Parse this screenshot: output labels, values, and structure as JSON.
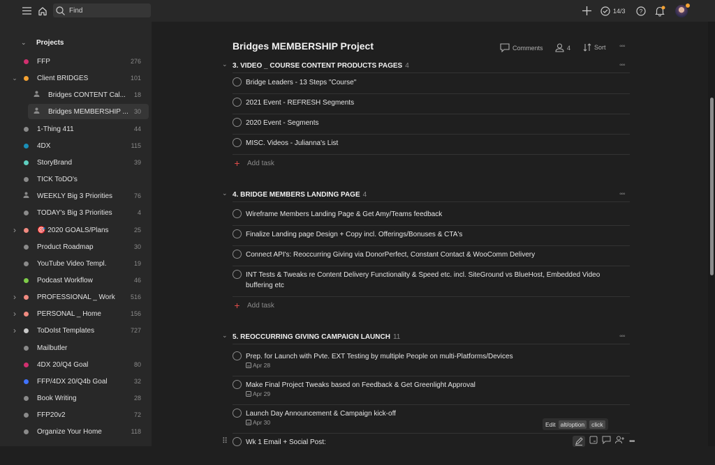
{
  "topbar": {
    "search_placeholder": "Find",
    "karma": "14/3"
  },
  "sidebar": {
    "projects_label": "Projects",
    "items": [
      {
        "label": "FFP",
        "count": "276",
        "color": "#d1306f",
        "type": "dot",
        "expand": "",
        "indent": 0
      },
      {
        "label": "Client BRIDGES",
        "count": "101",
        "color": "#f4a233",
        "type": "dot",
        "expand": "open",
        "indent": 0
      },
      {
        "label": "Bridges CONTENT Cal...",
        "count": "18",
        "color": "",
        "type": "person",
        "expand": "",
        "indent": 1
      },
      {
        "label": "Bridges MEMBERSHIP ...",
        "count": "30",
        "color": "",
        "type": "person",
        "expand": "",
        "indent": 1,
        "active": true
      },
      {
        "label": "1-Thing 411",
        "count": "44",
        "color": "#8a8a8a",
        "type": "dot",
        "expand": "",
        "indent": 0
      },
      {
        "label": "4DX",
        "count": "115",
        "color": "#1a8fb8",
        "type": "dot",
        "expand": "",
        "indent": 0
      },
      {
        "label": "StoryBrand",
        "count": "39",
        "color": "#5ecfc0",
        "type": "dot",
        "expand": "",
        "indent": 0
      },
      {
        "label": "TICK ToDO's",
        "count": "",
        "color": "#8a8a8a",
        "type": "dot",
        "expand": "",
        "indent": 0
      },
      {
        "label": "WEEKLY Big 3 Priorities",
        "count": "76",
        "color": "",
        "type": "person",
        "expand": "",
        "indent": 0
      },
      {
        "label": "TODAY's Big 3 Priorities",
        "count": "4",
        "color": "#8a8a8a",
        "type": "dot",
        "expand": "",
        "indent": 0
      },
      {
        "label": "🎯 2020 GOALS/Plans",
        "count": "25",
        "color": "#f08a80",
        "type": "dot",
        "expand": "closed",
        "indent": 0
      },
      {
        "label": "Product Roadmap",
        "count": "30",
        "color": "#8a8a8a",
        "type": "dot",
        "expand": "",
        "indent": 0
      },
      {
        "label": "YouTube Video Templ.",
        "count": "19",
        "color": "#8a8a8a",
        "type": "dot",
        "expand": "",
        "indent": 0
      },
      {
        "label": "Podcast Workflow",
        "count": "46",
        "color": "#7ecc49",
        "type": "dot",
        "expand": "",
        "indent": 0
      },
      {
        "label": "PROFESSIONAL _ Work",
        "count": "516",
        "color": "#f08a80",
        "type": "dot",
        "expand": "closed",
        "indent": 0
      },
      {
        "label": "PERSONAL _ Home",
        "count": "156",
        "color": "#f08a80",
        "type": "dot",
        "expand": "closed",
        "indent": 0
      },
      {
        "label": "ToDoIst Templates",
        "count": "727",
        "color": "#c8c8c8",
        "type": "dot",
        "expand": "closed",
        "indent": 0
      },
      {
        "label": "Mailbutler",
        "count": "",
        "color": "#8a8a8a",
        "type": "dot",
        "expand": "",
        "indent": 0
      },
      {
        "label": "4DX 20/Q4 Goal",
        "count": "80",
        "color": "#d1306f",
        "type": "dot",
        "expand": "",
        "indent": 0
      },
      {
        "label": "FFP/4DX 20/Q4b Goal",
        "count": "32",
        "color": "#4073ff",
        "type": "dot",
        "expand": "",
        "indent": 0
      },
      {
        "label": "Book Writing",
        "count": "28",
        "color": "#8a8a8a",
        "type": "dot",
        "expand": "",
        "indent": 0
      },
      {
        "label": "FFP20v2",
        "count": "72",
        "color": "#8a8a8a",
        "type": "dot",
        "expand": "",
        "indent": 0
      },
      {
        "label": "Organize Your Home",
        "count": "118",
        "color": "#8a8a8a",
        "type": "dot",
        "expand": "",
        "indent": 0
      }
    ]
  },
  "main": {
    "title": "Bridges MEMBERSHIP Project",
    "actions": {
      "comments": "Comments",
      "people_count": "4",
      "sort": "Sort"
    },
    "sections": [
      {
        "title": "3. VIDEO _ COURSE CONTENT PRODUCTS PAGES",
        "count": "4",
        "tasks": [
          {
            "text": "Bridge Leaders - 13 Steps \"Course\"",
            "date": ""
          },
          {
            "text": "2021 Event - REFRESH Segments",
            "date": ""
          },
          {
            "text": "2020 Event - Segments",
            "date": ""
          },
          {
            "text": "MISC. Videos - Julianna's List",
            "date": ""
          }
        ],
        "add_task": "Add task"
      },
      {
        "title": "4. BRIDGE MEMBERS LANDING PAGE",
        "count": "4",
        "tasks": [
          {
            "text": "Wireframe Members Landing Page & Get Amy/Teams feedback",
            "date": ""
          },
          {
            "text": "Finalize Landing page Design + Copy incl. Offerings/Bonuses & CTA's",
            "date": ""
          },
          {
            "text": "Connect API's: Reoccurring Giving via DonorPerfect, Constant Contact & WooComm Delivery",
            "date": ""
          },
          {
            "text": "INT Tests & Tweaks re Content Delivery Functionality & Speed etc. incl. SiteGround vs BlueHost, Embedded Video buffering etc",
            "date": ""
          }
        ],
        "add_task": "Add task"
      },
      {
        "title": "5. REOCCURRING GIVING CAMPAIGN LAUNCH",
        "count": "11",
        "tasks": [
          {
            "text": "Prep. for Launch with Pvte. EXT Testing by multiple People on multi-Platforms/Devices",
            "date": "Apr 28"
          },
          {
            "text": "Make Final Project Tweaks based on Feedback & Get Greenlight Approval",
            "date": "Apr 29"
          },
          {
            "text": "Launch Day Announcement & Campaign kick-off",
            "date": "Apr 30"
          },
          {
            "text": "Wk 1 Email + Social Post:",
            "date": ""
          }
        ]
      }
    ],
    "tooltip": {
      "label": "Edit",
      "key1": "alt/option",
      "key2": "click"
    }
  }
}
